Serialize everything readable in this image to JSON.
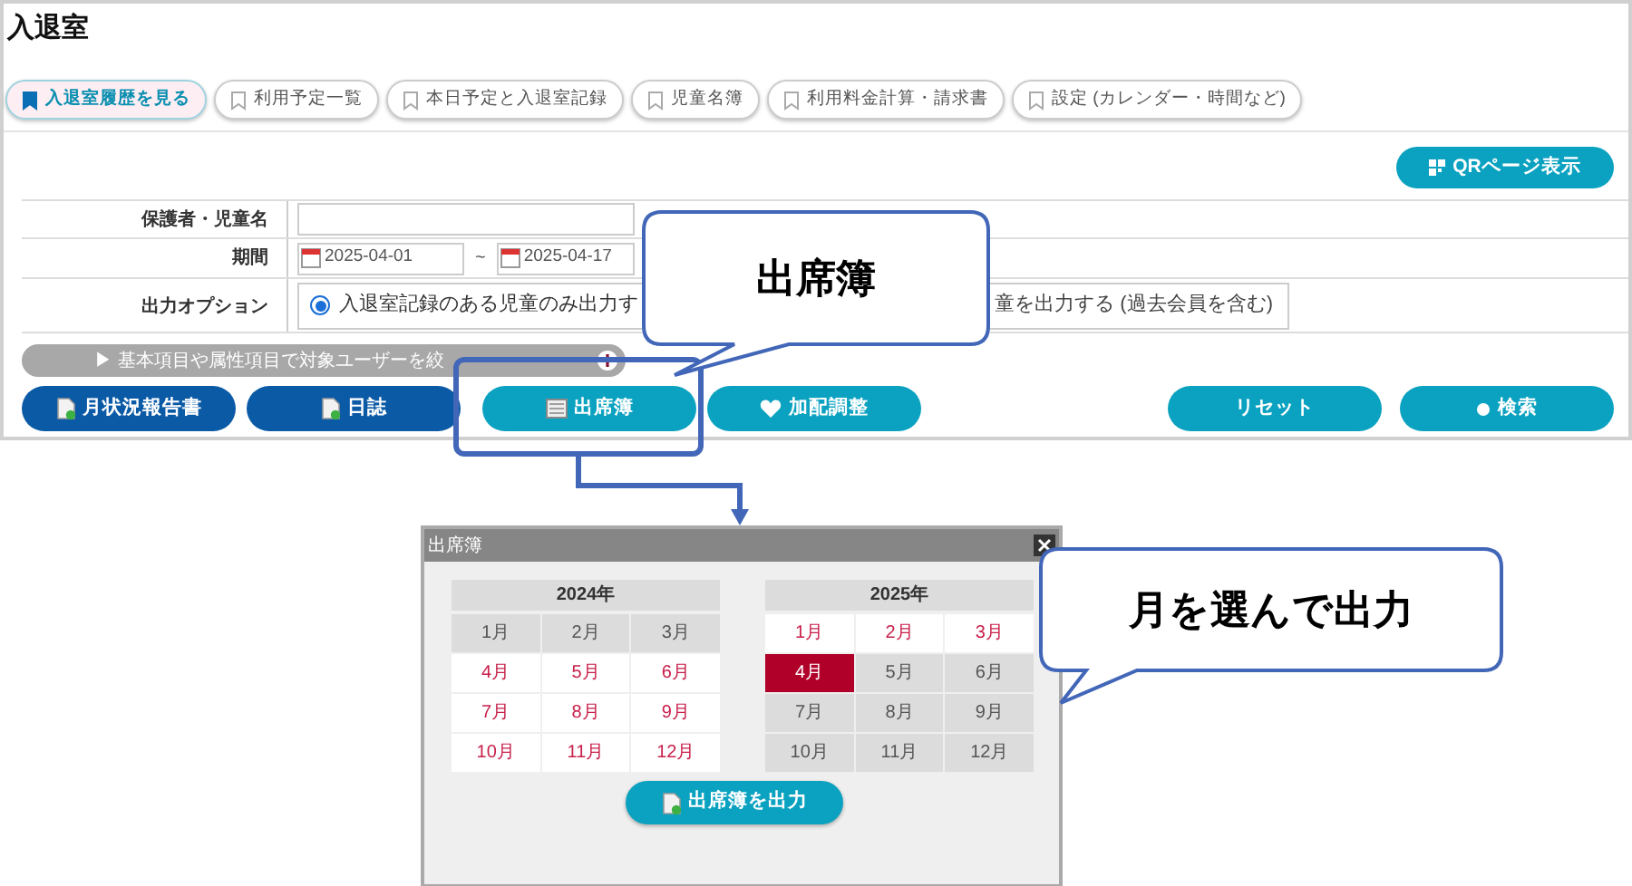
{
  "page_title": "入退室",
  "tabs": [
    {
      "label": "入退室履歴を見る",
      "selected": true
    },
    {
      "label": "利用予定一覧",
      "selected": false
    },
    {
      "label": "本日予定と入退室記録",
      "selected": false
    },
    {
      "label": "児童名簿",
      "selected": false
    },
    {
      "label": "利用料金計算・請求書",
      "selected": false
    },
    {
      "label": "設定 (カレンダー・時間など)",
      "selected": false
    }
  ],
  "qr_button": "QRページ表示",
  "form": {
    "guardian_label": "保護者・児童名",
    "period_label": "期間",
    "period_start": "2025-04-01",
    "period_separator": "~",
    "period_end": "2025-04-17",
    "output_label": "出力オプション",
    "options": [
      {
        "label": "入退室記録のある児童のみ出力す",
        "selected": true
      },
      {
        "label": "童を出力する (過去会員を含む)",
        "selected": false
      }
    ]
  },
  "filter_bar": "▶ 基本項目や属性項目で対象ユーザーを絞",
  "actions": [
    {
      "label": "月状況報告書",
      "kind": "document",
      "dark": true
    },
    {
      "label": "日誌",
      "kind": "document",
      "dark": true
    },
    {
      "label": "出席簿",
      "kind": "sheet",
      "dark": false
    },
    {
      "label": "加配調整",
      "kind": "heart",
      "dark": false
    },
    {
      "label": "リセット",
      "kind": "plain",
      "dark": false
    },
    {
      "label": "検索",
      "kind": "dot",
      "dark": false
    }
  ],
  "callouts": [
    {
      "text": "出席簿"
    },
    {
      "text": "月を選んで出力"
    }
  ],
  "dialog": {
    "title": "出席簿",
    "years": [
      {
        "label": "2024年",
        "months": [
          {
            "label": "1月",
            "available": false,
            "selected": false
          },
          {
            "label": "2月",
            "available": false,
            "selected": false
          },
          {
            "label": "3月",
            "available": false,
            "selected": false
          },
          {
            "label": "4月",
            "available": true,
            "selected": false
          },
          {
            "label": "5月",
            "available": true,
            "selected": false
          },
          {
            "label": "6月",
            "available": true,
            "selected": false
          },
          {
            "label": "7月",
            "available": true,
            "selected": false
          },
          {
            "label": "8月",
            "available": true,
            "selected": false
          },
          {
            "label": "9月",
            "available": true,
            "selected": false
          },
          {
            "label": "10月",
            "available": true,
            "selected": false
          },
          {
            "label": "11月",
            "available": true,
            "selected": false
          },
          {
            "label": "12月",
            "available": true,
            "selected": false
          }
        ]
      },
      {
        "label": "2025年",
        "months": [
          {
            "label": "1月",
            "available": true,
            "selected": false
          },
          {
            "label": "2月",
            "available": true,
            "selected": false
          },
          {
            "label": "3月",
            "available": true,
            "selected": false
          },
          {
            "label": "4月",
            "available": true,
            "selected": true
          },
          {
            "label": "5月",
            "available": false,
            "selected": false
          },
          {
            "label": "6月",
            "available": false,
            "selected": false
          },
          {
            "label": "7月",
            "available": false,
            "selected": false
          },
          {
            "label": "8月",
            "available": false,
            "selected": false
          },
          {
            "label": "9月",
            "available": false,
            "selected": false
          },
          {
            "label": "10月",
            "available": false,
            "selected": false
          },
          {
            "label": "11月",
            "available": false,
            "selected": false
          },
          {
            "label": "12月",
            "available": false,
            "selected": false
          }
        ]
      }
    ],
    "export_button": "出席簿を出力"
  }
}
